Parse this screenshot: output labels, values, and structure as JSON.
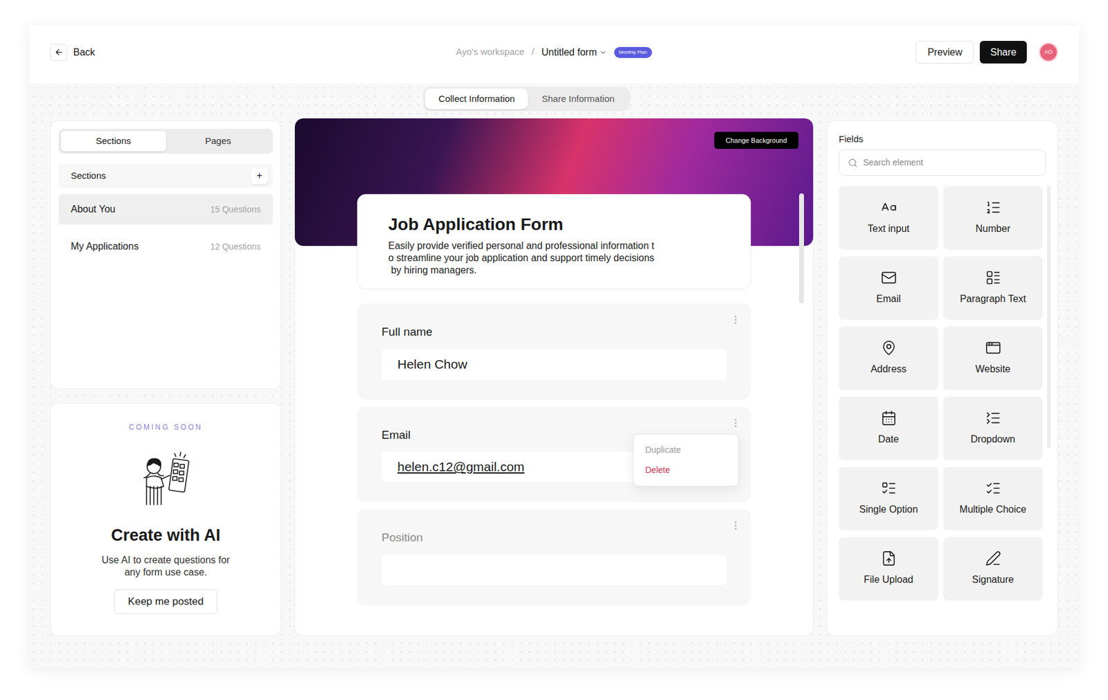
{
  "header": {
    "back": "Back",
    "workspace": "Ayo's workspace",
    "separator": "/",
    "form_title": "Untitled form",
    "plan_badge": "Monthly Plan",
    "preview": "Preview",
    "share": "Share",
    "avatar": "AO"
  },
  "tabs": [
    {
      "label": "Collect Information",
      "selected": true
    },
    {
      "label": "Share Information",
      "selected": false
    }
  ],
  "sidebar": {
    "segments": [
      {
        "label": "Sections",
        "selected": true
      },
      {
        "label": "Pages",
        "selected": false
      }
    ],
    "sections_header": "Sections",
    "add": "+",
    "items": [
      {
        "name": "About You",
        "count": "15 Questions",
        "selected": true
      },
      {
        "name": "My Applications",
        "count": "12 Questions",
        "selected": false
      }
    ]
  },
  "ai_card": {
    "badge": "COMING SOON",
    "title": "Create with AI",
    "description": "Use AI to create questions for any form use case.",
    "button": "Keep me posted"
  },
  "form": {
    "change_background": "Change Background",
    "title": "Job Application Form",
    "description_lines": [
      "Easily provide verified personal and professional information t",
      "o streamline your job application and support timely decisions",
      " by hiring managers."
    ],
    "fields": [
      {
        "label": "Full name",
        "value": "Helen Chow",
        "muted": false,
        "link": false,
        "menu_open": false
      },
      {
        "label": "Email",
        "value": "helen.c12@gmail.com",
        "muted": false,
        "link": true,
        "menu_open": true
      },
      {
        "label": "Position",
        "value": "",
        "muted": true,
        "link": false,
        "menu_open": false
      }
    ],
    "menu": [
      {
        "label": "Duplicate",
        "danger": false
      },
      {
        "label": "Delete",
        "danger": true
      }
    ]
  },
  "elements_panel": {
    "title": "Fields",
    "search_placeholder": "Search element",
    "elements": [
      {
        "label": "Text input",
        "kind": "text"
      },
      {
        "label": "Number",
        "kind": "number"
      },
      {
        "label": "Email",
        "kind": "email"
      },
      {
        "label": "Paragraph Text",
        "kind": "paragraph"
      },
      {
        "label": "Address",
        "kind": "address"
      },
      {
        "label": "Website",
        "kind": "website"
      },
      {
        "label": "Date",
        "kind": "date"
      },
      {
        "label": "Dropdown",
        "kind": "dropdown"
      },
      {
        "label": "Single Option",
        "kind": "single"
      },
      {
        "label": "Multiple Choice",
        "kind": "multiple"
      },
      {
        "label": "File Upload",
        "kind": "file"
      },
      {
        "label": "Signature",
        "kind": "signature"
      }
    ]
  }
}
